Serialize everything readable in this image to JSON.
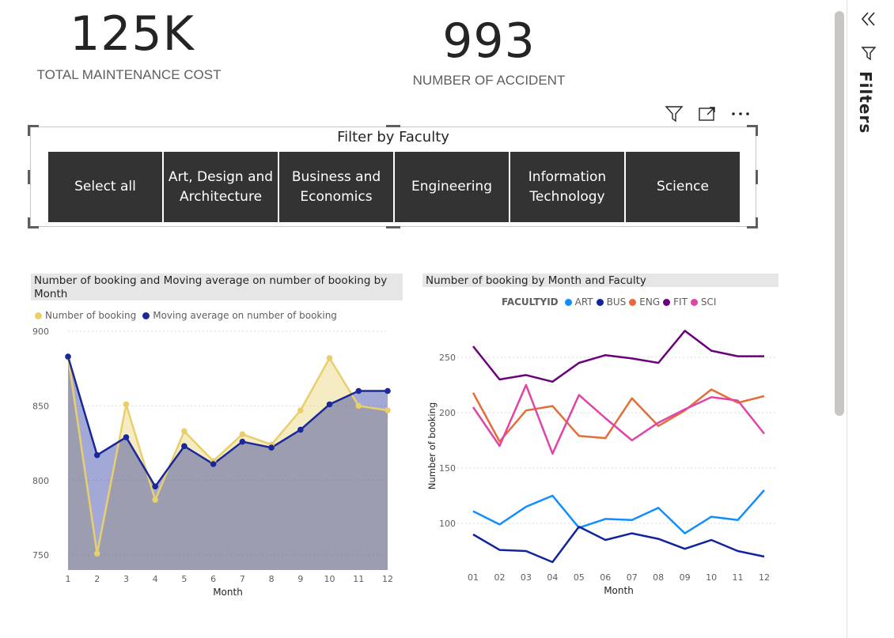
{
  "kpis": {
    "maintenance_value": "125K",
    "maintenance_label": "TOTAL MAINTENANCE COST",
    "accident_value": "993",
    "accident_label": "NUMBER OF ACCIDENT"
  },
  "icons": {
    "filter": "filter-icon",
    "focus": "focus-mode-icon",
    "more": "more-options-icon",
    "collapse": "double-chevron-left-icon",
    "funnel": "funnel-icon"
  },
  "slicer": {
    "title": "Filter by Faculty",
    "buttons": [
      "Select all",
      "Art, Design and Architecture",
      "Business and Economics",
      "Engineering",
      "Information Technology",
      "Science"
    ]
  },
  "filters_pane": {
    "label": "Filters"
  },
  "colors": {
    "booking": "#e8cf6c",
    "moving_avg": "#1a2899",
    "ART": "#118dff",
    "BUS": "#12239e",
    "ENG": "#e66c37",
    "FIT": "#6b007b",
    "SCI": "#e044a7"
  },
  "chart_data": [
    {
      "type": "area",
      "title": "Number of booking and Moving average on number of booking by Month",
      "xlabel": "Month",
      "ylabel": "",
      "x": [
        1,
        2,
        3,
        4,
        5,
        6,
        7,
        8,
        9,
        10,
        11,
        12
      ],
      "series": [
        {
          "name": "Number of booking",
          "values": [
            883,
            751,
            851,
            787,
            833,
            813,
            831,
            824,
            847,
            882,
            850,
            847
          ]
        },
        {
          "name": "Moving average on number of booking",
          "values": [
            883,
            817,
            829,
            796,
            823,
            811,
            826,
            822,
            834,
            851,
            860,
            860
          ]
        }
      ],
      "yticks": [
        750,
        800,
        850,
        900
      ],
      "ylim": [
        740,
        900
      ],
      "legend": "top-left",
      "grid": true
    },
    {
      "type": "line",
      "title": "Number of booking by Month and Faculty",
      "legend_title": "FACULTYID",
      "xlabel": "Month",
      "ylabel": "Number of booking",
      "x": [
        "01",
        "02",
        "03",
        "04",
        "05",
        "06",
        "07",
        "08",
        "09",
        "10",
        "11",
        "12"
      ],
      "series": [
        {
          "name": "ART",
          "values": [
            111,
            99,
            115,
            125,
            96,
            104,
            103,
            114,
            91,
            106,
            103,
            130
          ]
        },
        {
          "name": "BUS",
          "values": [
            90,
            76,
            75,
            65,
            97,
            85,
            91,
            86,
            77,
            85,
            75,
            70
          ]
        },
        {
          "name": "ENG",
          "values": [
            218,
            174,
            202,
            206,
            179,
            177,
            213,
            188,
            202,
            221,
            209,
            215
          ]
        },
        {
          "name": "FIT",
          "values": [
            260,
            230,
            234,
            228,
            245,
            252,
            249,
            245,
            274,
            256,
            251,
            251
          ]
        },
        {
          "name": "SCI",
          "values": [
            205,
            170,
            225,
            163,
            216,
            195,
            175,
            191,
            203,
            214,
            211,
            181
          ]
        }
      ],
      "yticks": [
        100,
        150,
        200,
        250
      ],
      "ylim": [
        60,
        280
      ],
      "legend": "top-center",
      "grid": true
    }
  ]
}
